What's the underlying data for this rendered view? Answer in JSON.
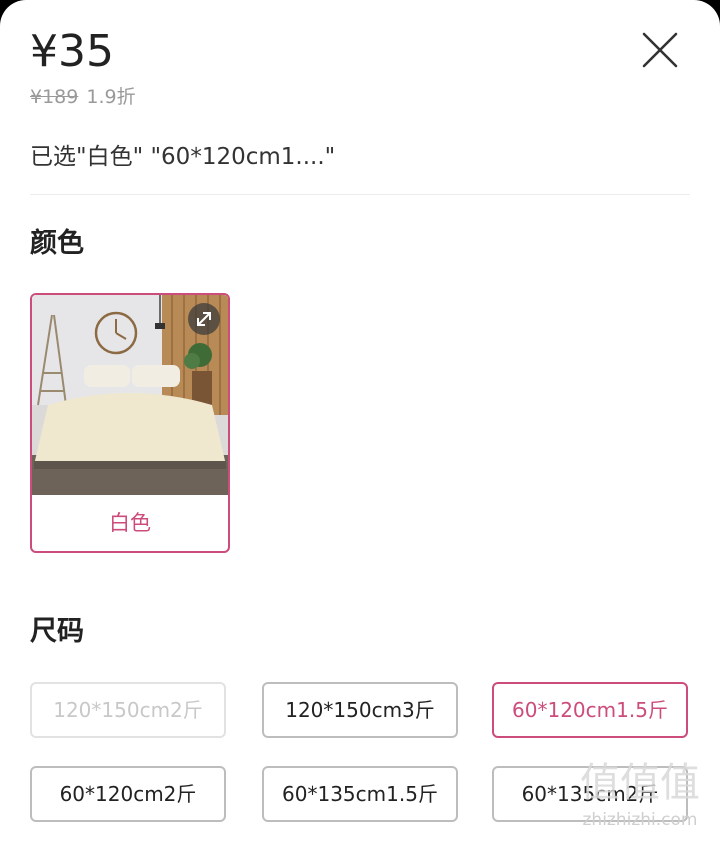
{
  "product": {
    "price": "¥35",
    "original_price": "¥189",
    "discount": "1.9折",
    "selected_text": "已选\"白色\" \"60*120cm1....\""
  },
  "color_section": {
    "title": "颜色",
    "options": [
      {
        "label": "白色",
        "selected": true
      }
    ]
  },
  "size_section": {
    "title": "尺码",
    "options": [
      {
        "label": "120*150cm2斤",
        "state": "disabled"
      },
      {
        "label": "120*150cm3斤",
        "state": "normal"
      },
      {
        "label": "60*120cm1.5斤",
        "state": "selected"
      },
      {
        "label": "60*120cm2斤",
        "state": "normal"
      },
      {
        "label": "60*135cm1.5斤",
        "state": "normal"
      },
      {
        "label": "60*135cm2斤",
        "state": "normal"
      }
    ]
  },
  "watermark": {
    "text": "zhizhizhi.com",
    "logo_text": "值值值"
  },
  "colors": {
    "accent": "#cc4c7b",
    "text": "#222222",
    "muted": "#9a9a9a"
  },
  "icons": {
    "close": "close-icon",
    "expand": "expand-icon"
  }
}
